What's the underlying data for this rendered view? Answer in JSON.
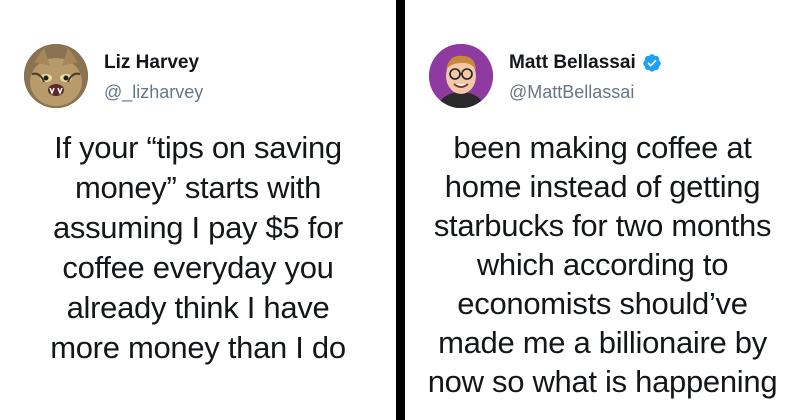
{
  "tweets": [
    {
      "name": "Liz Harvey",
      "handle": "@_lizharvey",
      "verified": false,
      "avatar": "cat-avatar",
      "lines": [
        "If your “tips on saving",
        "money” starts with",
        "assuming I pay $5 for",
        "coffee everyday you",
        "already think I have",
        "more money than I do"
      ]
    },
    {
      "name": "Matt Bellassai",
      "handle": "@MattBellassai",
      "verified": true,
      "avatar": "man-with-glasses-avatar",
      "lines": [
        "been making coffee at",
        "home instead of getting",
        "starbucks for two months",
        "which according to",
        "economists should’ve",
        "made me a billionaire by",
        "now so what is happening"
      ]
    }
  ],
  "colors": {
    "verified_badge": "#1da1f2",
    "separator": "#000000"
  }
}
